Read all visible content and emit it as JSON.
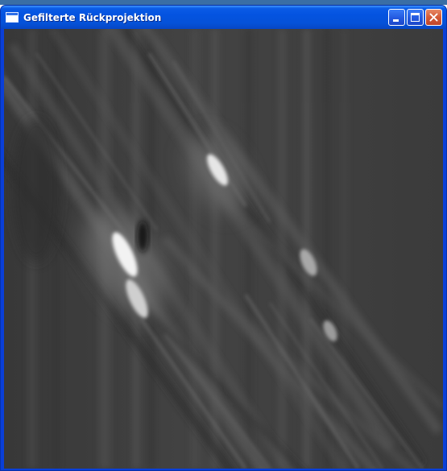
{
  "window": {
    "title": "Gefilterte Rückprojektion",
    "app_icon": "window-icon",
    "controls": {
      "minimize_icon": "minimize-icon",
      "maximize_icon": "maximize-icon",
      "close_icon": "close-icon"
    }
  },
  "image": {
    "description_kind": "filtered-back-projection-reconstruction",
    "colormap": "grayscale",
    "background_color": "#404040"
  },
  "theme": {
    "titlebar_color": "#0453e0",
    "close_button_color": "#d35a37",
    "frame_color": "#0a3fd8"
  }
}
